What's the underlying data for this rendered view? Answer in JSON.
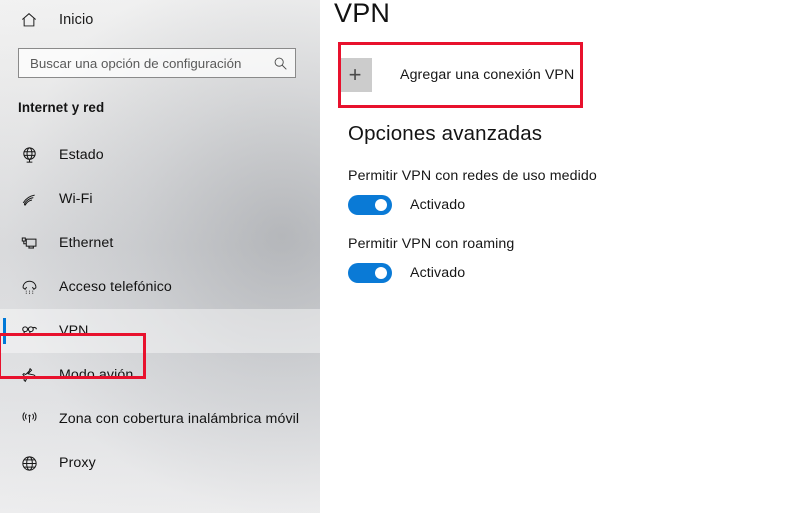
{
  "sidebar": {
    "home": {
      "label": "Inicio",
      "icon": "home-icon"
    },
    "search": {
      "placeholder": "Buscar una opción de configuración",
      "value": "",
      "icon": "search-icon"
    },
    "group_title": "Internet y red",
    "items": [
      {
        "label": "Estado",
        "icon": "status-globe-icon",
        "selected": false
      },
      {
        "label": "Wi-Fi",
        "icon": "wifi-icon",
        "selected": false
      },
      {
        "label": "Ethernet",
        "icon": "ethernet-icon",
        "selected": false
      },
      {
        "label": "Acceso telefónico",
        "icon": "dialup-phone-icon",
        "selected": false
      },
      {
        "label": "VPN",
        "icon": "vpn-icon",
        "selected": true
      },
      {
        "label": "Modo avión",
        "icon": "airplane-icon",
        "selected": false
      },
      {
        "label": "Zona con cobertura inalámbrica móvil",
        "icon": "hotspot-icon",
        "selected": false
      },
      {
        "label": "Proxy",
        "icon": "globe-icon",
        "selected": false
      }
    ]
  },
  "content": {
    "title": "VPN",
    "add_vpn": {
      "label": "Agregar una conexión VPN",
      "icon": "plus-icon"
    },
    "advanced": {
      "title": "Opciones avanzadas",
      "settings": [
        {
          "label": "Permitir VPN con redes de uso medido",
          "state": "Activado",
          "on": true
        },
        {
          "label": "Permitir VPN con roaming",
          "state": "Activado",
          "on": true
        }
      ]
    }
  },
  "annotations": {
    "highlight_color": "#e8112d",
    "accent_color": "#0078d7",
    "toggle_on_color": "#0a7ad6"
  }
}
